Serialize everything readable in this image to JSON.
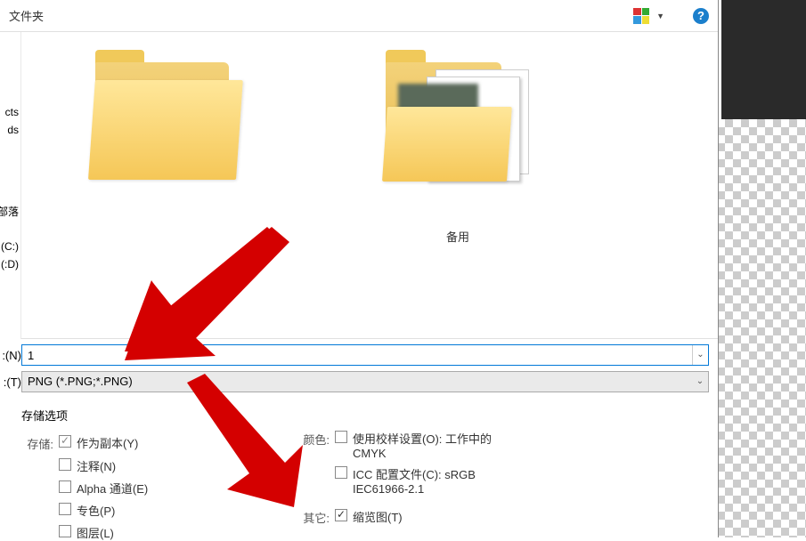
{
  "toolbar": {
    "new_folder_label": "文件夹"
  },
  "sidebar": {
    "items": [
      {
        "label": "cts"
      },
      {
        "label": "ds"
      },
      {
        "label": "系部落"
      },
      {
        "label": "s (C:)"
      },
      {
        "label": " (D:)"
      }
    ]
  },
  "folders": [
    {
      "label": ""
    },
    {
      "label": "备用"
    }
  ],
  "fields": {
    "filename_hotkey": "(N):",
    "filename_value": "1",
    "filetype_hotkey": "(T):",
    "filetype_value": "PNG (*.PNG;*.PNG)"
  },
  "options": {
    "section_title": "存储选项",
    "save_label": "存储:",
    "as_copy": "作为副本(Y)",
    "notes": "注释(N)",
    "alpha": "Alpha 通道(E)",
    "spot": "专色(P)",
    "layers": "图层(L)",
    "color_label": "颜色:",
    "proof": "使用校样设置(O): 工作中的 CMYK",
    "icc": "ICC 配置文件(C): sRGB IEC61966-2.1",
    "other_label": "其它:",
    "thumbnail": "缩览图(T)"
  }
}
